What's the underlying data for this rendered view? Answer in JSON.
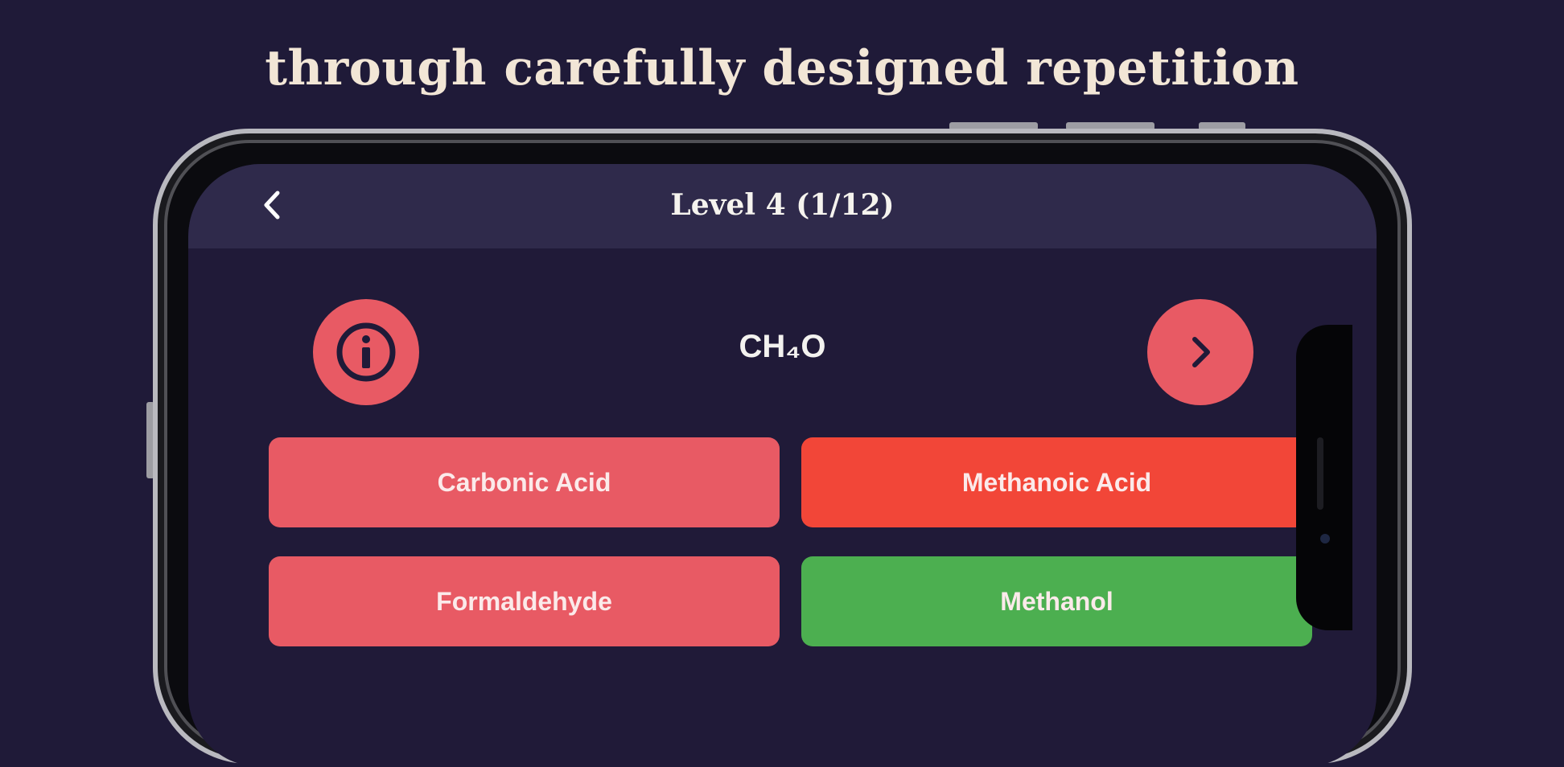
{
  "headline": "through carefully designed repetition",
  "topbar": {
    "back_icon": "chevron-left-icon",
    "title": "Level 4 (1/12)"
  },
  "question": {
    "formula": "CH₄O",
    "info_icon": "info-circle-icon",
    "next_icon": "chevron-right-icon"
  },
  "answers": [
    {
      "label": "Carbonic Acid",
      "state": "neutral",
      "color": "#e85a64"
    },
    {
      "label": "Methanoic Acid",
      "state": "wrong",
      "color": "#f24638"
    },
    {
      "label": "Formaldehyde",
      "state": "neutral",
      "color": "#e85a64"
    },
    {
      "label": "Methanol",
      "state": "correct",
      "color": "#4caf50"
    }
  ],
  "colors": {
    "background": "#1f1a38",
    "topbar": "#2f2a4b",
    "accent": "#e85a64",
    "headline_text": "#f2e6d6"
  }
}
